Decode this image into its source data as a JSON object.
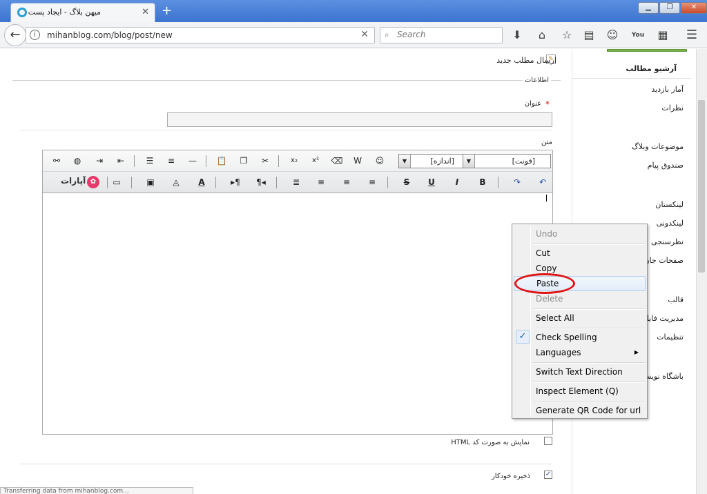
{
  "browser": {
    "tab_title": "میهن بلاگ - ایجاد پست",
    "tab_close": "✕",
    "new_tab": "+",
    "win_min": "▁",
    "win_max": "❐",
    "win_close": "✕",
    "back": "←",
    "url": "mihanblog.com/blog/post/new",
    "url_clear": "✕",
    "search_placeholder": "Search"
  },
  "sidebar": {
    "archive": "آرشیو مطالب",
    "items": [
      {
        "label": "آمار بازدید"
      },
      {
        "label": "نظرات"
      },
      {
        "label": "موضوعات وبلاگ"
      },
      {
        "label": "صندوق پیام"
      },
      {
        "label": "لینکستان"
      },
      {
        "label": "لینکدونی"
      },
      {
        "label": "نظرسنجی"
      },
      {
        "label": "صفحات جان"
      },
      {
        "label": "قالب"
      },
      {
        "label": "مدیریت فایل"
      },
      {
        "label": "تنظیمات"
      },
      {
        "label": "باشگاه نویسندگان"
      }
    ]
  },
  "form": {
    "new_post": "ارسال مطلب جدید",
    "info_legend": "اطلاعات",
    "title_label": "عنوان",
    "required_mark": "*",
    "body_label": "متن",
    "font_select": "[فونت]",
    "size_select": "[اندازه]",
    "aparat": "آپارات",
    "html_label": "نمایش به صورت کد HTML",
    "html_checked": false,
    "autosave_label": "ذخیره خودکار",
    "autosave_checked": true,
    "status_text": "Transferring data from mihanblog.com..."
  },
  "context_menu": {
    "items": [
      {
        "label": "Undo",
        "enabled": false
      },
      {
        "label": "Cut",
        "enabled": true
      },
      {
        "label": "Copy",
        "enabled": true
      },
      {
        "label": "Paste",
        "enabled": true,
        "highlighted": true
      },
      {
        "label": "Delete",
        "enabled": false
      },
      {
        "label": "Select All",
        "enabled": true
      },
      {
        "label": "Check Spelling",
        "enabled": true,
        "checked": true
      },
      {
        "label": "Languages",
        "enabled": true,
        "submenu": true
      },
      {
        "label": "Switch Text Direction",
        "enabled": true
      },
      {
        "label": "Inspect Element (Q)",
        "enabled": true
      },
      {
        "label": "Generate QR Code for url",
        "enabled": true
      }
    ]
  },
  "colors": {
    "accent": "#3d74d0",
    "highlight_circle": "#e01414",
    "required": "#dd0000"
  }
}
